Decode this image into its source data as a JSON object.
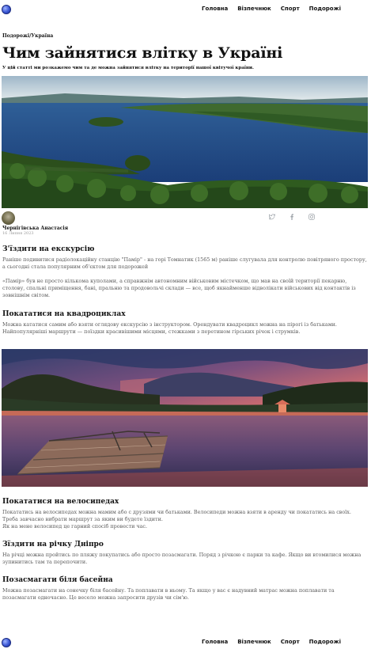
{
  "nav": {
    "links": [
      "Головна",
      "Візпечнюк",
      "Спорт",
      "Подорожі"
    ]
  },
  "article": {
    "breadcrumb": "Подорожі/Україна",
    "title": "Чим зайнятися влітку в Україні",
    "subtitle": "У цій статті ми розкажемо чим та де можна зайнятися влітку на території нашої квітучої країни.",
    "author": "Чернігівська Анастасія",
    "date": "16 Липня 2023",
    "social_icons": [
      "twitter-icon",
      "facebook-icon",
      "instagram-icon"
    ],
    "sections": [
      {
        "heading": "З'їздити на екскурсію",
        "paragraphs": [
          "Раніше подивитися радіолокаційну станцію \"Памір\" - на горі Томнатик (1565 м) раніше слугувала для контролю повітряного простору, а сьогодні стала популярним об'єктом для подорожей",
          "«Памір» був не просто кількома куполами, а справжнім автономним військовим містечком, що мав на своїй території пекарню, столову, спальні приміщення, бані, пральню та продовольчі склади — все, щоб якнайменше відволікати військових від контактів із зовнішнім світом."
        ]
      },
      {
        "heading": "Покататися на квадроциклах",
        "paragraphs": [
          "Можна кататися самим або взяти оглядову екскурсію з інструктором. Орендувати квадроцикл можна на пірогі із батьками. Найпопулярніші маршрути — поїздки красивішими місцями, стежками з перетином гірських річок і струмків."
        ]
      },
      {
        "heading": "Покататися на велосипедах",
        "paragraphs": [
          "Покататись на велосипедах можна мамим або с друзями чи батьками. Велосипеди можна взяти в аренду чи покататись на своїх. Треба завчасно вибрати маршрут за яким ви будете їздити.",
          "Як на мене велосипед це гарний спосіб провести час."
        ]
      },
      {
        "heading": "Зїздити на річку Дніпро",
        "paragraphs": [
          "На річці можна пройтись по пляжу покупатись або просто позасмагати. Поряд з річкою є парки та кафе. Якщо ви втомилися можна зупинитись там та перепочити."
        ]
      },
      {
        "heading": "Позасмагати біля басейна",
        "paragraphs": [
          "Можна позасмагати на сонечку біля басейну. Та поплавати в ньому. Та якщо у вас є надувний матрас можна поплавати та позасмагати одночасно. Це весело можна запросити друзів чи сім'ю."
        ]
      }
    ]
  },
  "colors": {
    "text": "#111111",
    "muted_text": "#5a5a5a",
    "date": "#9a9a9a",
    "icon": "#9aa0a6",
    "logo": "#3a56d4"
  }
}
